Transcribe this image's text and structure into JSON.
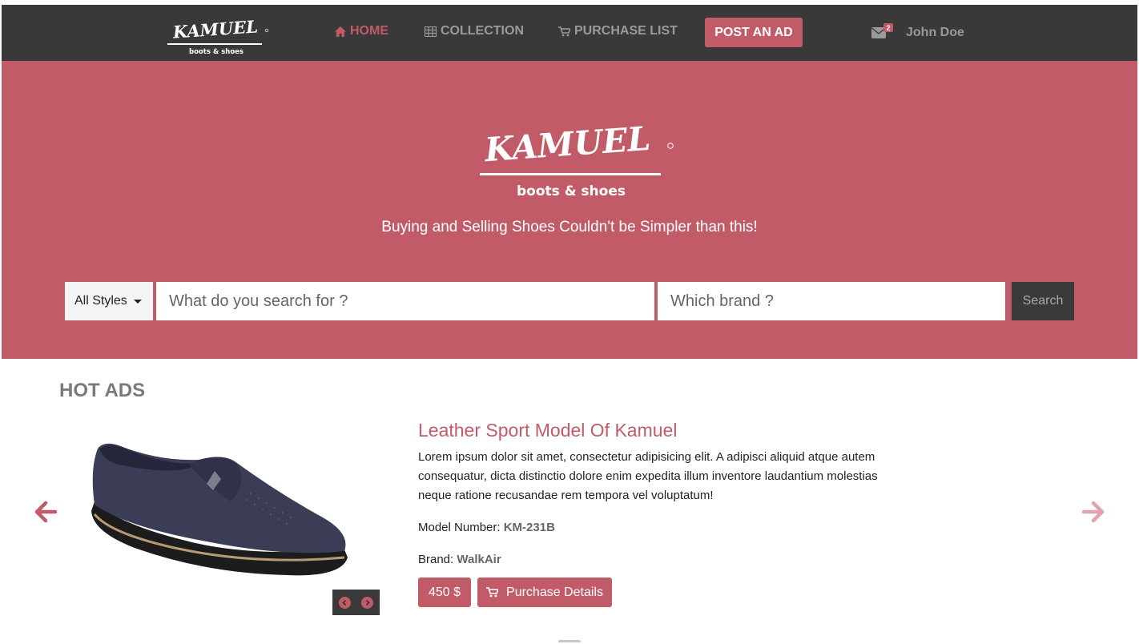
{
  "brand": {
    "logo_text": "KAMUEL",
    "logo_subtext": "boots & shoes"
  },
  "nav": {
    "home": "HOME",
    "collection": "COLLECTION",
    "purchase_list": "PURCHASE LIST",
    "post_ad": "POST AN AD",
    "mail_count": "2",
    "user": "John Doe"
  },
  "hero": {
    "tagline": "Buying and Selling Shoes Couldn't be Simpler than this!",
    "styles_dropdown": "All Styles",
    "search_placeholder": "What do you search for ?",
    "brand_placeholder": "Which brand ?",
    "search_button": "Search"
  },
  "hot_ads": {
    "title": "HOT ADS",
    "product": {
      "name": "Leather Sport Model Of Kamuel",
      "description": "Lorem ipsum dolor sit amet, consectetur adipisicing elit. A adipisci aliquid atque autem consequatur, dicta distinctio dolore enim expedita illum inventore laudantium molestias neque ratione recusandae rem tempora vel voluptatum!",
      "model_label": "Model Number:",
      "model_value": "KM-231B",
      "brand_label": "Brand:",
      "brand_value": "WalkAir",
      "price": "450 $",
      "details_button": "Purchase Details"
    }
  },
  "colors": {
    "accent": "#c25b68",
    "navbar": "#393939",
    "nav_text": "#9a9a9a"
  },
  "icons": {
    "home": "home-icon",
    "collection": "table-icon",
    "purchase": "cart-icon",
    "mail": "envelope-icon",
    "prev": "arrow-left-icon",
    "next": "arrow-right-icon"
  }
}
